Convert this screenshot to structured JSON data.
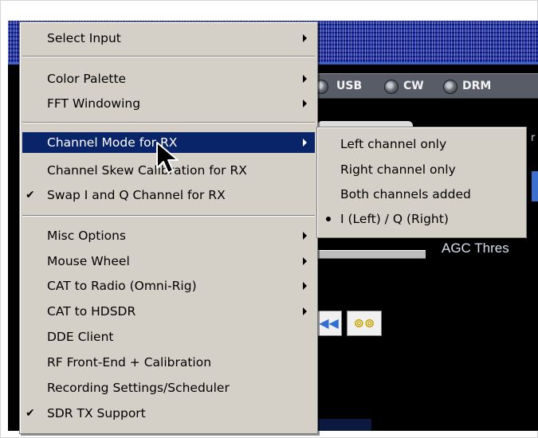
{
  "background_app": {
    "mode_buttons": [
      "USB",
      "CW",
      "DRM"
    ],
    "agc_label": "AGC Thres",
    "side_label": "r",
    "skip_icon": "skip-back-icon",
    "loop_icon": "loop-icon"
  },
  "main_menu": {
    "items": [
      {
        "label": "Select Input",
        "submenu": true,
        "checked": false
      },
      {
        "label": "Color Palette",
        "submenu": true,
        "checked": false
      },
      {
        "label": "FFT Windowing",
        "submenu": true,
        "checked": false
      },
      {
        "label": "Channel Mode for RX",
        "submenu": true,
        "checked": false,
        "highlighted": true
      },
      {
        "label": "Channel Skew Calibration for RX",
        "submenu": false,
        "checked": false
      },
      {
        "label": "Swap I and Q Channel for RX",
        "submenu": false,
        "checked": true
      },
      {
        "label": "Misc Options",
        "submenu": true,
        "checked": false
      },
      {
        "label": "Mouse Wheel",
        "submenu": true,
        "checked": false
      },
      {
        "label": "CAT to Radio (Omni-Rig)",
        "submenu": true,
        "checked": false
      },
      {
        "label": "CAT to HDSDR",
        "submenu": true,
        "checked": false
      },
      {
        "label": "DDE Client",
        "submenu": false,
        "checked": false
      },
      {
        "label": "RF Front-End + Calibration",
        "submenu": false,
        "checked": false
      },
      {
        "label": "Recording Settings/Scheduler",
        "submenu": false,
        "checked": false
      },
      {
        "label": "SDR TX Support",
        "submenu": false,
        "checked": true
      }
    ],
    "check_glyph": "✔"
  },
  "sub_menu": {
    "items": [
      {
        "label": "Left channel only",
        "selected": false
      },
      {
        "label": "Right channel only",
        "selected": false
      },
      {
        "label": "Both channels added",
        "selected": false
      },
      {
        "label": "I (Left) / Q (Right)",
        "selected": true
      }
    ]
  },
  "colors": {
    "menu_bg": "#d4d0c8",
    "highlight": "#0a246a",
    "app_bg": "#000000"
  }
}
